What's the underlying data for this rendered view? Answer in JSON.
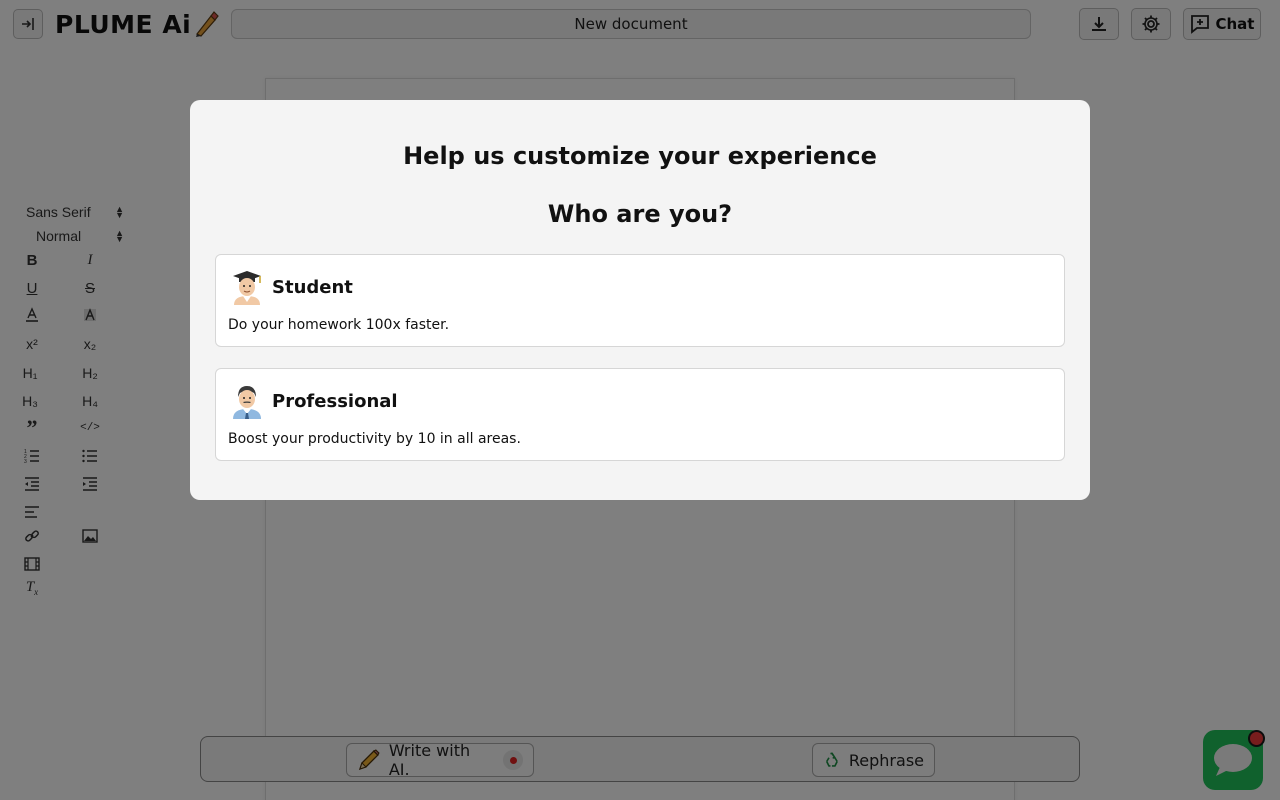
{
  "header": {
    "logo_text": "PLUME Ai",
    "document_title": "New document",
    "chat_label": "Chat"
  },
  "toolbar": {
    "font_family": "Sans Serif",
    "font_size": "Normal"
  },
  "modal": {
    "title": "Help us customize your experience",
    "subtitle": "Who are you?",
    "options": [
      {
        "label": "Student",
        "description": "Do your homework 100x faster.",
        "icon": "student-emoji"
      },
      {
        "label": "Professional",
        "description": "Boost your productivity by 10 in all areas.",
        "icon": "professional-emoji"
      }
    ]
  },
  "bottom_bar": {
    "write_label": "Write with AI.",
    "rephrase_label": "Rephrase"
  },
  "colors": {
    "accent_green": "#20c25a",
    "notification_red": "#ef3b3b",
    "record_red": "#e02020"
  }
}
